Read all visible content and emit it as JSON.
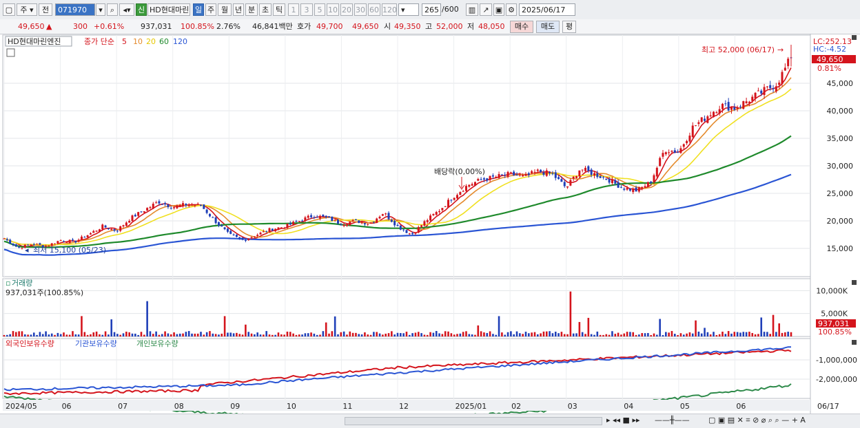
{
  "toolbar": {
    "market_label": "주",
    "prev_label": "전",
    "code_value": "071970",
    "stock_name": "HD현대마린",
    "new_badge": "신",
    "period_tabs": [
      "일",
      "주",
      "월",
      "년",
      "분",
      "초",
      "틱"
    ],
    "selected_period": "일",
    "interval_buttons": [
      "1",
      "3",
      "5",
      "10",
      "20",
      "30",
      "60",
      "120"
    ],
    "count_value": "265",
    "count_max": "/600",
    "date_value": "2025/06/17"
  },
  "quote": {
    "price": "49,650",
    "change": "300",
    "change_pct": "+0.61%",
    "volume": "937,031",
    "volume_ratio": "100.85%",
    "turnover_rate": "2.76%",
    "amount": "46,841백만",
    "bid_label": "호가",
    "ask_price": "49,700",
    "bid_price": "49,650",
    "open_label": "시",
    "open": "49,350",
    "high_label": "고",
    "high": "52,000",
    "low_label": "저",
    "low": "48,050",
    "buy_label": "매수",
    "sell_label": "매도",
    "avg_label": "평"
  },
  "chart_data": [
    {
      "type": "candlestick",
      "title": "HD현대마린엔진",
      "legend": {
        "prefix": "종가 단순",
        "periods": [
          "5",
          "10",
          "20",
          "60",
          "120"
        ],
        "colors": [
          "#d4141c",
          "#e48a2c",
          "#f0e020",
          "#1f8a2c",
          "#2a55d4"
        ]
      },
      "ylim": [
        10000,
        53500
      ],
      "y_ticks": [
        15000,
        20000,
        25000,
        30000,
        35000,
        40000,
        45000
      ],
      "y_tick_labels": [
        "15,000",
        "20,000",
        "25,000",
        "30,000",
        "35,000",
        "40,000",
        "45,000"
      ],
      "close_series": [
        {
          "date": "2024-05-20",
          "close": 16800
        },
        {
          "date": "2024-05-23",
          "close": 15100
        },
        {
          "date": "2024-05-31",
          "close": 15800
        },
        {
          "date": "2024-06-10",
          "close": 15400
        },
        {
          "date": "2024-06-20",
          "close": 16500
        },
        {
          "date": "2024-06-28",
          "close": 16200
        },
        {
          "date": "2024-07-05",
          "close": 17500
        },
        {
          "date": "2024-07-12",
          "close": 19000
        },
        {
          "date": "2024-07-19",
          "close": 18200
        },
        {
          "date": "2024-07-26",
          "close": 20500
        },
        {
          "date": "2024-08-02",
          "close": 22000
        },
        {
          "date": "2024-08-09",
          "close": 23500
        },
        {
          "date": "2024-08-16",
          "close": 22500
        },
        {
          "date": "2024-08-23",
          "close": 23000
        },
        {
          "date": "2024-08-30",
          "close": 22800
        },
        {
          "date": "2024-09-06",
          "close": 20000
        },
        {
          "date": "2024-09-13",
          "close": 17500
        },
        {
          "date": "2024-09-20",
          "close": 16500
        },
        {
          "date": "2024-09-27",
          "close": 17500
        },
        {
          "date": "2024-10-04",
          "close": 18500
        },
        {
          "date": "2024-10-11",
          "close": 19000
        },
        {
          "date": "2024-10-18",
          "close": 20000
        },
        {
          "date": "2024-10-25",
          "close": 21000
        },
        {
          "date": "2024-11-01",
          "close": 20500
        },
        {
          "date": "2024-11-08",
          "close": 19500
        },
        {
          "date": "2024-11-15",
          "close": 20000
        },
        {
          "date": "2024-11-22",
          "close": 19500
        },
        {
          "date": "2024-11-29",
          "close": 21500
        },
        {
          "date": "2024-12-06",
          "close": 19000
        },
        {
          "date": "2024-12-13",
          "close": 17500
        },
        {
          "date": "2024-12-20",
          "close": 20000
        },
        {
          "date": "2024-12-27",
          "close": 22000
        },
        {
          "date": "2025-01-03",
          "close": 24500
        },
        {
          "date": "2025-01-10",
          "close": 26500
        },
        {
          "date": "2025-01-17",
          "close": 27500
        },
        {
          "date": "2025-01-24",
          "close": 28000
        },
        {
          "date": "2025-01-31",
          "close": 28500
        },
        {
          "date": "2025-02-07",
          "close": 28000
        },
        {
          "date": "2025-02-14",
          "close": 29000
        },
        {
          "date": "2025-02-21",
          "close": 28500
        },
        {
          "date": "2025-02-28",
          "close": 26000
        },
        {
          "date": "2025-03-07",
          "close": 29500
        },
        {
          "date": "2025-03-14",
          "close": 28500
        },
        {
          "date": "2025-03-21",
          "close": 27500
        },
        {
          "date": "2025-03-28",
          "close": 26000
        },
        {
          "date": "2025-04-04",
          "close": 25500
        },
        {
          "date": "2025-04-11",
          "close": 27000
        },
        {
          "date": "2025-04-18",
          "close": 33000
        },
        {
          "date": "2025-04-25",
          "close": 32500
        },
        {
          "date": "2025-05-02",
          "close": 37000
        },
        {
          "date": "2025-05-09",
          "close": 39000
        },
        {
          "date": "2025-05-16",
          "close": 41000
        },
        {
          "date": "2025-05-23",
          "close": 40500
        },
        {
          "date": "2025-05-30",
          "close": 42000
        },
        {
          "date": "2025-06-05",
          "close": 43500
        },
        {
          "date": "2025-06-12",
          "close": 45000
        },
        {
          "date": "2025-06-17",
          "close": 49650
        }
      ],
      "annotations": {
        "high": "최고 52,000 (06/17)",
        "low": "최저 15,100 (05/23)",
        "dividend": "배당락(0,00%)"
      },
      "right_labels": {
        "lc": "LC:252.13",
        "hc": "HC:-4.52",
        "last_price": "49,650",
        "last_pct": "0.81%"
      }
    },
    {
      "type": "bar",
      "title": "거래량",
      "current": "937,031주(100.85%)",
      "ylim": [
        0,
        12000
      ],
      "y_ticks": [
        5000,
        10000
      ],
      "y_tick_labels": [
        "5,000K",
        "10,000K"
      ],
      "last_value": "937,031",
      "last_pct": "100.85%"
    },
    {
      "type": "line",
      "series_names": [
        "외국인보유수량",
        "기관보유수량",
        "개인보유수량"
      ],
      "series_colors": [
        "#d4141c",
        "#2a55d4",
        "#2e8a4a"
      ],
      "ylim": [
        -3000000,
        0
      ],
      "y_ticks": [
        -1000000,
        -2000000
      ],
      "y_tick_labels": [
        "-1,000,000",
        "-2,000,000"
      ]
    }
  ],
  "x_axis": {
    "labels": [
      "2024/05",
      "06",
      "07",
      "08",
      "09",
      "10",
      "11",
      "12",
      "2025/01",
      "02",
      "03",
      "04",
      "05",
      "06"
    ],
    "last_date": "06/17"
  }
}
